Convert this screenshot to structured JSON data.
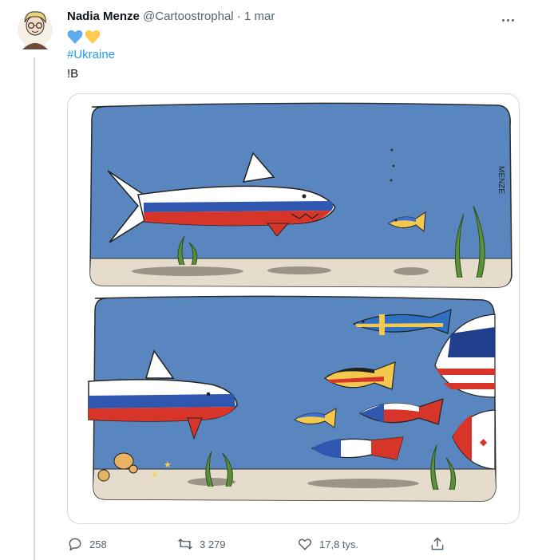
{
  "tweet": {
    "author_name": "Nadia Menze",
    "author_handle": "@Cartoostrophal",
    "separator": "·",
    "date": "1 mar",
    "hashtag": "#Ukraine",
    "line2": "!B",
    "emojis": [
      {
        "name": "blue-heart-icon",
        "color": "#5dadec"
      },
      {
        "name": "yellow-heart-icon",
        "color": "#ffcc4d"
      }
    ]
  },
  "media": {
    "signature": "MENZE",
    "flags": [
      "Russia",
      "Ukraine",
      "Sweden",
      "USA",
      "Germany",
      "Czechia",
      "France",
      "Canada"
    ]
  },
  "actions": {
    "replies": "258",
    "retweets": "3 279",
    "likes": "17,8 tys."
  },
  "colors": {
    "link": "#1d9bf0",
    "muted": "#536471",
    "water": "#5a86c0",
    "sand": "#e6dccb"
  }
}
